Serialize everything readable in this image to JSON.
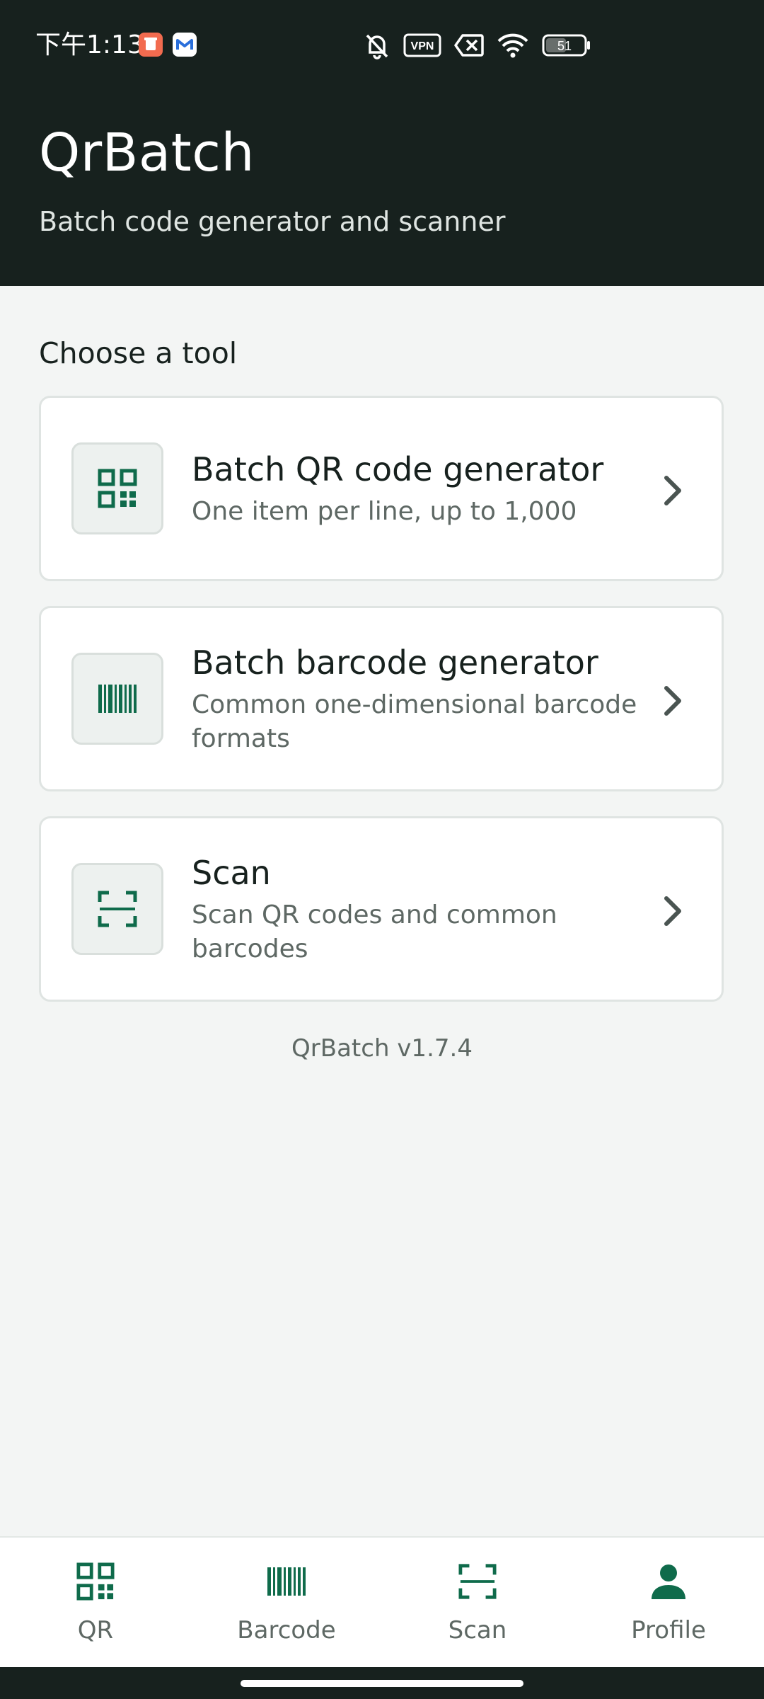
{
  "status_bar": {
    "time": "下午1:13",
    "battery": "51",
    "vpn_label": "VPN",
    "icons": [
      "orange-app-notification-icon",
      "gmail-notification-icon",
      "bell-off-icon",
      "vpn-icon",
      "sim-disabled-icon",
      "wifi-icon",
      "battery-icon"
    ]
  },
  "header": {
    "title": "QrBatch",
    "subtitle": "Batch code generator and scanner"
  },
  "main": {
    "section_title": "Choose a tool",
    "tools": [
      {
        "title": "Batch QR code generator",
        "description": "One item per line, up to 1,000",
        "icon": "qr-code-icon"
      },
      {
        "title": "Batch barcode generator",
        "description": "Common one-dimensional barcode formats",
        "icon": "barcode-icon"
      },
      {
        "title": "Scan",
        "description": "Scan QR codes and common barcodes",
        "icon": "scan-frame-icon"
      }
    ],
    "version": "QrBatch v1.7.4"
  },
  "bottom_nav": {
    "items": [
      {
        "label": "QR",
        "icon": "qr-code-icon"
      },
      {
        "label": "Barcode",
        "icon": "barcode-icon"
      },
      {
        "label": "Scan",
        "icon": "scan-frame-icon"
      },
      {
        "label": "Profile",
        "icon": "person-icon"
      }
    ]
  },
  "colors": {
    "header_bg": "#17211e",
    "page_bg": "#f3f5f4",
    "accent": "#0f6b4b",
    "text_primary": "#17211e",
    "text_secondary": "#5e6864"
  }
}
